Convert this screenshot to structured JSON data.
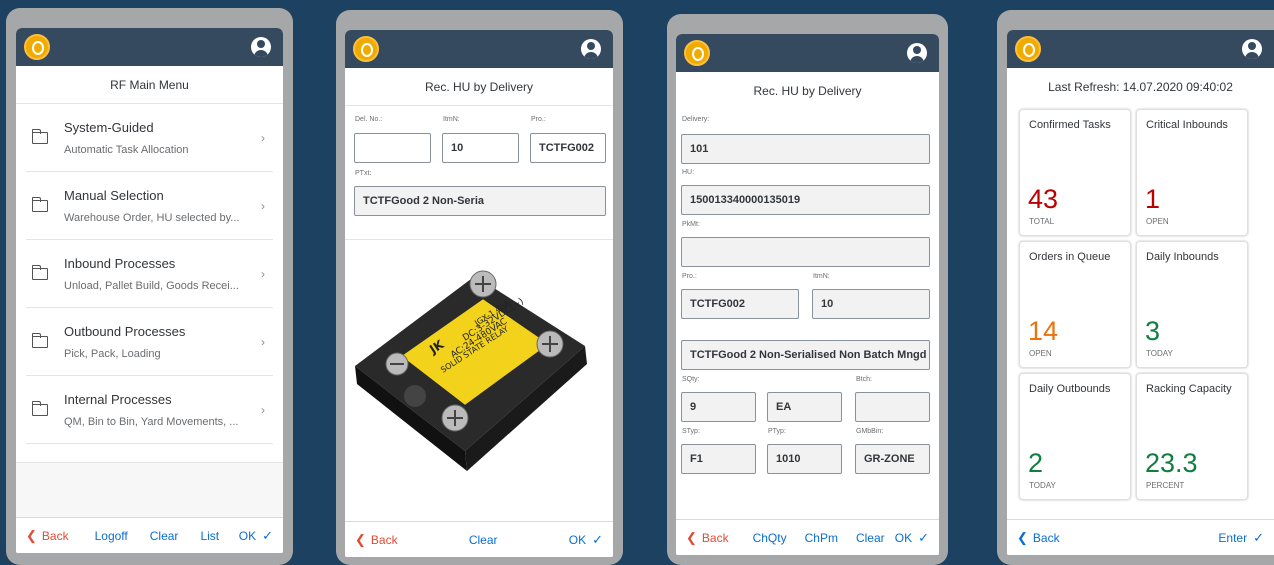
{
  "colors": {
    "background": "#1d4160",
    "shell": "#354a5f",
    "accent": "#0a6ed1",
    "critical": "#bb0000",
    "warning": "#e9730c",
    "good": "#107e3e",
    "back": "#e14b35"
  },
  "icons": {
    "logo": "sap-logo-icon",
    "user": "user-icon",
    "folder": "folder-icon",
    "chevron": "chevron-right-icon",
    "back": "chevron-left-icon",
    "check": "checkmark-icon"
  },
  "screen1": {
    "title": "RF Main Menu",
    "items": [
      {
        "title": "System-Guided",
        "subtitle": "Automatic Task Allocation"
      },
      {
        "title": "Manual Selection",
        "subtitle": "Warehouse Order, HU selected by..."
      },
      {
        "title": "Inbound Processes",
        "subtitle": "Unload, Pallet Build, Goods Recei..."
      },
      {
        "title": "Outbound Processes",
        "subtitle": "Pick, Pack, Loading"
      },
      {
        "title": "Internal Processes",
        "subtitle": "QM, Bin to Bin, Yard Movements, ..."
      }
    ],
    "footer": {
      "back": "Back",
      "logoff": "Logoff",
      "clear": "Clear",
      "list": "List",
      "ok": "OK"
    }
  },
  "screen2": {
    "title": "Rec. HU by Delivery",
    "fields": {
      "del_no_label": "Del. No.:",
      "del_no_value": "",
      "itmn_label": "ItmN:",
      "itmn_value": "10",
      "pro_label": "Pro.:",
      "pro_value": "TCTFG002",
      "ptxt_label": "PTxt:",
      "ptxt_value": "TCTFGood 2 Non-Seria"
    },
    "product_label": {
      "l1": "DC:3-32VDC(+)",
      "l2": "AC:24-480VAC",
      "l3": "SOLID STATE RELAY",
      "brand": "JK",
      "model": "JGX-1 40A"
    },
    "footer": {
      "back": "Back",
      "clear": "Clear",
      "ok": "OK"
    }
  },
  "screen3": {
    "title": "Rec. HU by Delivery",
    "fields": {
      "delivery_label": "Delivery:",
      "delivery_value": "101",
      "hu_label": "HU:",
      "hu_value": "150013340000135019",
      "pkmt_label": "PkMt:",
      "pkmt_value": "",
      "pro_label": "Pro.:",
      "pro_value": "TCTFG002",
      "itmn_label": "ItmN:",
      "itmn_value": "10",
      "desc_value": "TCTFGood 2 Non-Serialised Non Batch Mngd",
      "sqty_label": "SQty:",
      "sqty_value": "9",
      "uom_value": "EA",
      "btch_label": "Btch:",
      "btch_value": "",
      "styp_label": "STyp:",
      "styp_value": "F1",
      "ptyp_label": "PTyp:",
      "ptyp_value": "1010",
      "gmbbin_label": "GMbBin:",
      "gmbbin_value": "GR-ZONE"
    },
    "footer": {
      "back": "Back",
      "chqty": "ChQty",
      "chpm": "ChPm",
      "clear": "Clear",
      "ok": "OK"
    }
  },
  "screen4": {
    "title": "Last Refresh: 14.07.2020 09:40:02",
    "tiles": [
      {
        "title": "Confirmed Tasks",
        "value": "43",
        "unit": "TOTAL",
        "color": "#bb0000"
      },
      {
        "title": "Critical Inbounds",
        "value": "1",
        "unit": "OPEN",
        "color": "#bb0000"
      },
      {
        "title": "Orders in Queue",
        "value": "14",
        "unit": "OPEN",
        "color": "#e9730c"
      },
      {
        "title": "Daily Inbounds",
        "value": "3",
        "unit": "TODAY",
        "color": "#107e3e"
      },
      {
        "title": "Daily Outbounds",
        "value": "2",
        "unit": "TODAY",
        "color": "#107e3e"
      },
      {
        "title": "Racking Capacity",
        "value": "23.3",
        "unit": "PERCENT",
        "color": "#107e3e"
      }
    ],
    "footer": {
      "back": "Back",
      "enter": "Enter"
    }
  }
}
